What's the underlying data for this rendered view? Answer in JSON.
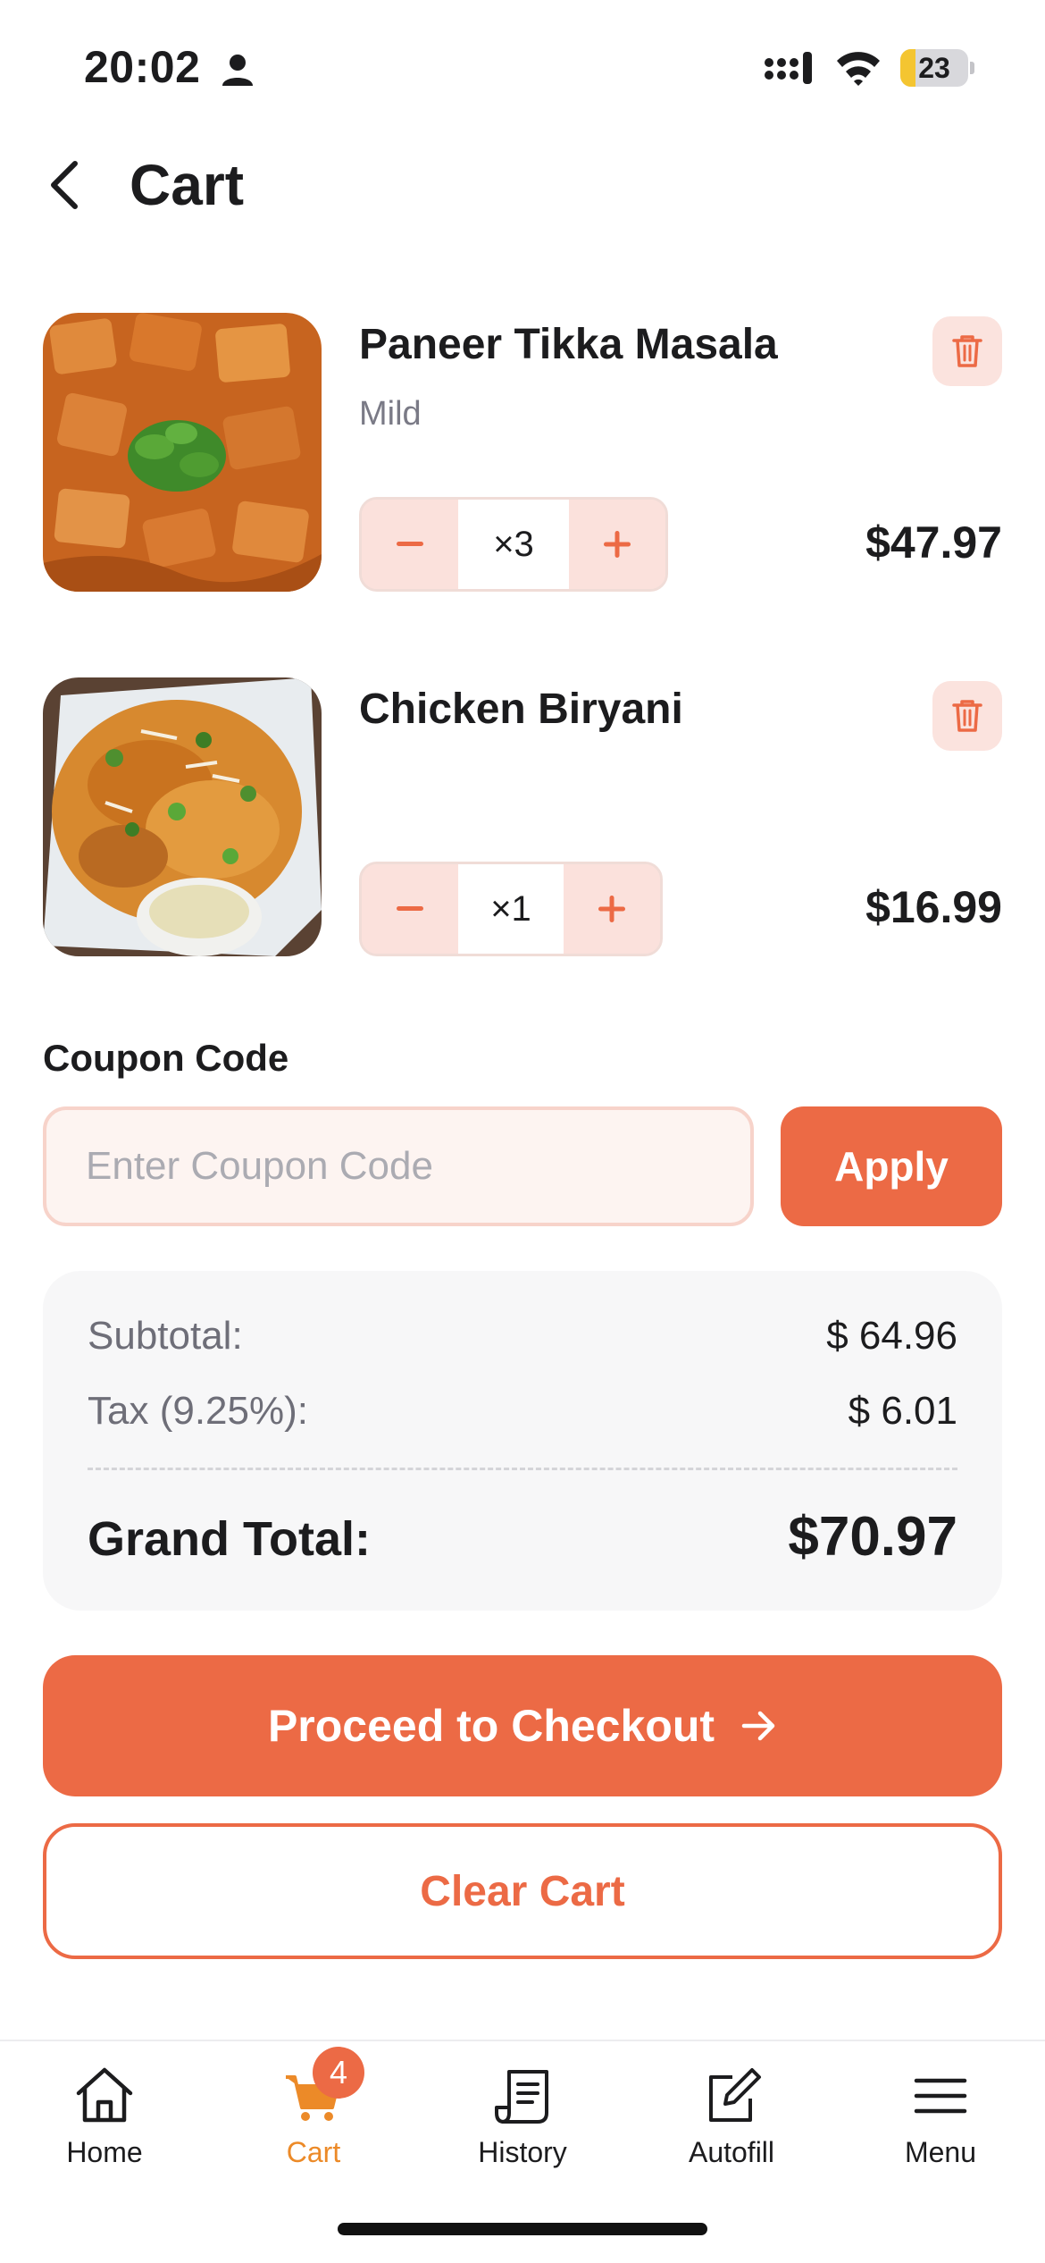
{
  "status_bar": {
    "time": "20:02",
    "battery": "23",
    "battery_level": 0.23
  },
  "header": {
    "title": "Cart"
  },
  "cart_items": [
    {
      "name": "Paneer Tikka Masala",
      "option": "Mild",
      "quantity": "×3",
      "price": "$47.97",
      "image": "paneer-tikka-masala-photo"
    },
    {
      "name": "Chicken Biryani",
      "option": "",
      "quantity": "×1",
      "price": "$16.99",
      "image": "chicken-biryani-photo"
    }
  ],
  "coupon": {
    "label": "Coupon Code",
    "placeholder": "Enter Coupon Code",
    "value": "",
    "apply_label": "Apply"
  },
  "summary": {
    "subtotal_label": "Subtotal:",
    "subtotal_value": "$ 64.96",
    "tax_label": "Tax (9.25%):",
    "tax_value": "$ 6.01",
    "grand_total_label": "Grand Total:",
    "grand_total_value": "$70.97"
  },
  "actions": {
    "checkout_label": "Proceed to Checkout",
    "clear_label": "Clear Cart"
  },
  "tab_bar": {
    "tabs": [
      {
        "label": "Home",
        "icon": "home-icon"
      },
      {
        "label": "Cart",
        "icon": "cart-icon",
        "badge": "4",
        "active": true
      },
      {
        "label": "History",
        "icon": "receipt-icon"
      },
      {
        "label": "Autofill",
        "icon": "edit-icon"
      },
      {
        "label": "Menu",
        "icon": "hamburger-icon"
      }
    ]
  },
  "colors": {
    "accent": "#ec6a45",
    "active_tab": "#ec8a28",
    "accent_light": "#fbe3de",
    "text": "#1c1c1e",
    "muted": "#6e6e78"
  }
}
